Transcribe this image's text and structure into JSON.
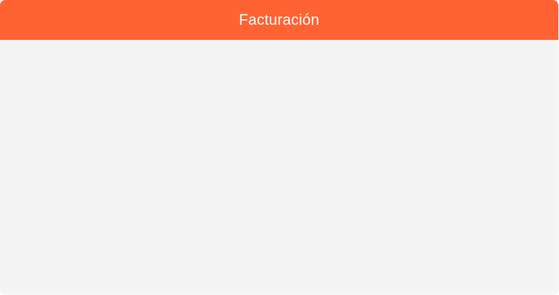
{
  "panel": {
    "title": "Facturación"
  },
  "colors": {
    "header_background": "#ff6333",
    "header_text": "#ffffff",
    "body_background": "#f4f4f4"
  }
}
